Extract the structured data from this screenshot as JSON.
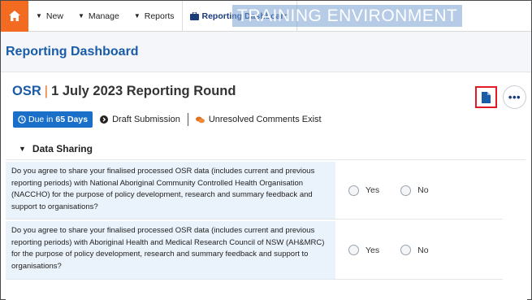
{
  "nav": {
    "items": [
      {
        "label": "New"
      },
      {
        "label": "Manage"
      },
      {
        "label": "Reports"
      }
    ],
    "active_label": "Reporting Dashboard",
    "environment_banner": "TRAINING ENVIRONMENT"
  },
  "page": {
    "title": "Reporting Dashboard"
  },
  "round": {
    "program": "OSR",
    "title": "1 July 2023 Reporting Round",
    "due_prefix": "Due in",
    "due_value": "65 Days",
    "submission_status": "Draft Submission",
    "comments_status": "Unresolved Comments Exist"
  },
  "section": {
    "title": "Data Sharing",
    "questions": [
      {
        "text": "Do you agree to share your finalised processed OSR data (includes current and previous reporting periods) with National Aboriginal Community Controlled Health Organisation (NACCHO) for the purpose of policy development, research and summary feedback and support to organisations?",
        "options": [
          "Yes",
          "No"
        ]
      },
      {
        "text": "Do you agree to share your finalised processed OSR data (includes current and previous reporting periods) with Aboriginal Health and Medical Research Council of NSW (AH&MRC) for the purpose of policy development, research and summary feedback and support to organisations?",
        "options": [
          "Yes",
          "No"
        ]
      }
    ]
  },
  "colors": {
    "home": "#f26b21",
    "title_blue": "#1a5ca8",
    "badge_blue": "#1a6fc9",
    "highlight_red": "#e01b24",
    "question_bg": "#eaf2fb"
  },
  "icons": {
    "home": "home-icon",
    "dashboard": "briefcase-icon",
    "document": "document-icon",
    "more": "ellipsis-icon",
    "clock": "clock-icon",
    "arrow": "arrow-circle-right-icon",
    "comments": "comments-icon",
    "chevron": "chevron-down-icon"
  }
}
